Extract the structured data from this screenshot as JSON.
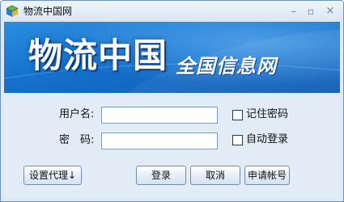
{
  "window": {
    "title": "物流中国网"
  },
  "banner": {
    "title": "物流中国",
    "subtitle": "全国信息网"
  },
  "form": {
    "username_label": "用户名:",
    "username_value": "",
    "password_label": "密　码:",
    "password_value": "",
    "remember_password_label": "记住密码",
    "remember_password_checked": false,
    "auto_login_label": "自动登录",
    "auto_login_checked": false
  },
  "buttons": {
    "proxy": "设置代理↓",
    "login": "登录",
    "cancel": "取消",
    "register": "申请帐号"
  },
  "titlebar_icons": [
    "app-cube-icon",
    "minimize-icon",
    "maximize-icon",
    "close-icon"
  ],
  "colors": {
    "banner_blue": "#1572cc",
    "window_bg": "#dfe9f5",
    "border": "#6f93b8"
  }
}
